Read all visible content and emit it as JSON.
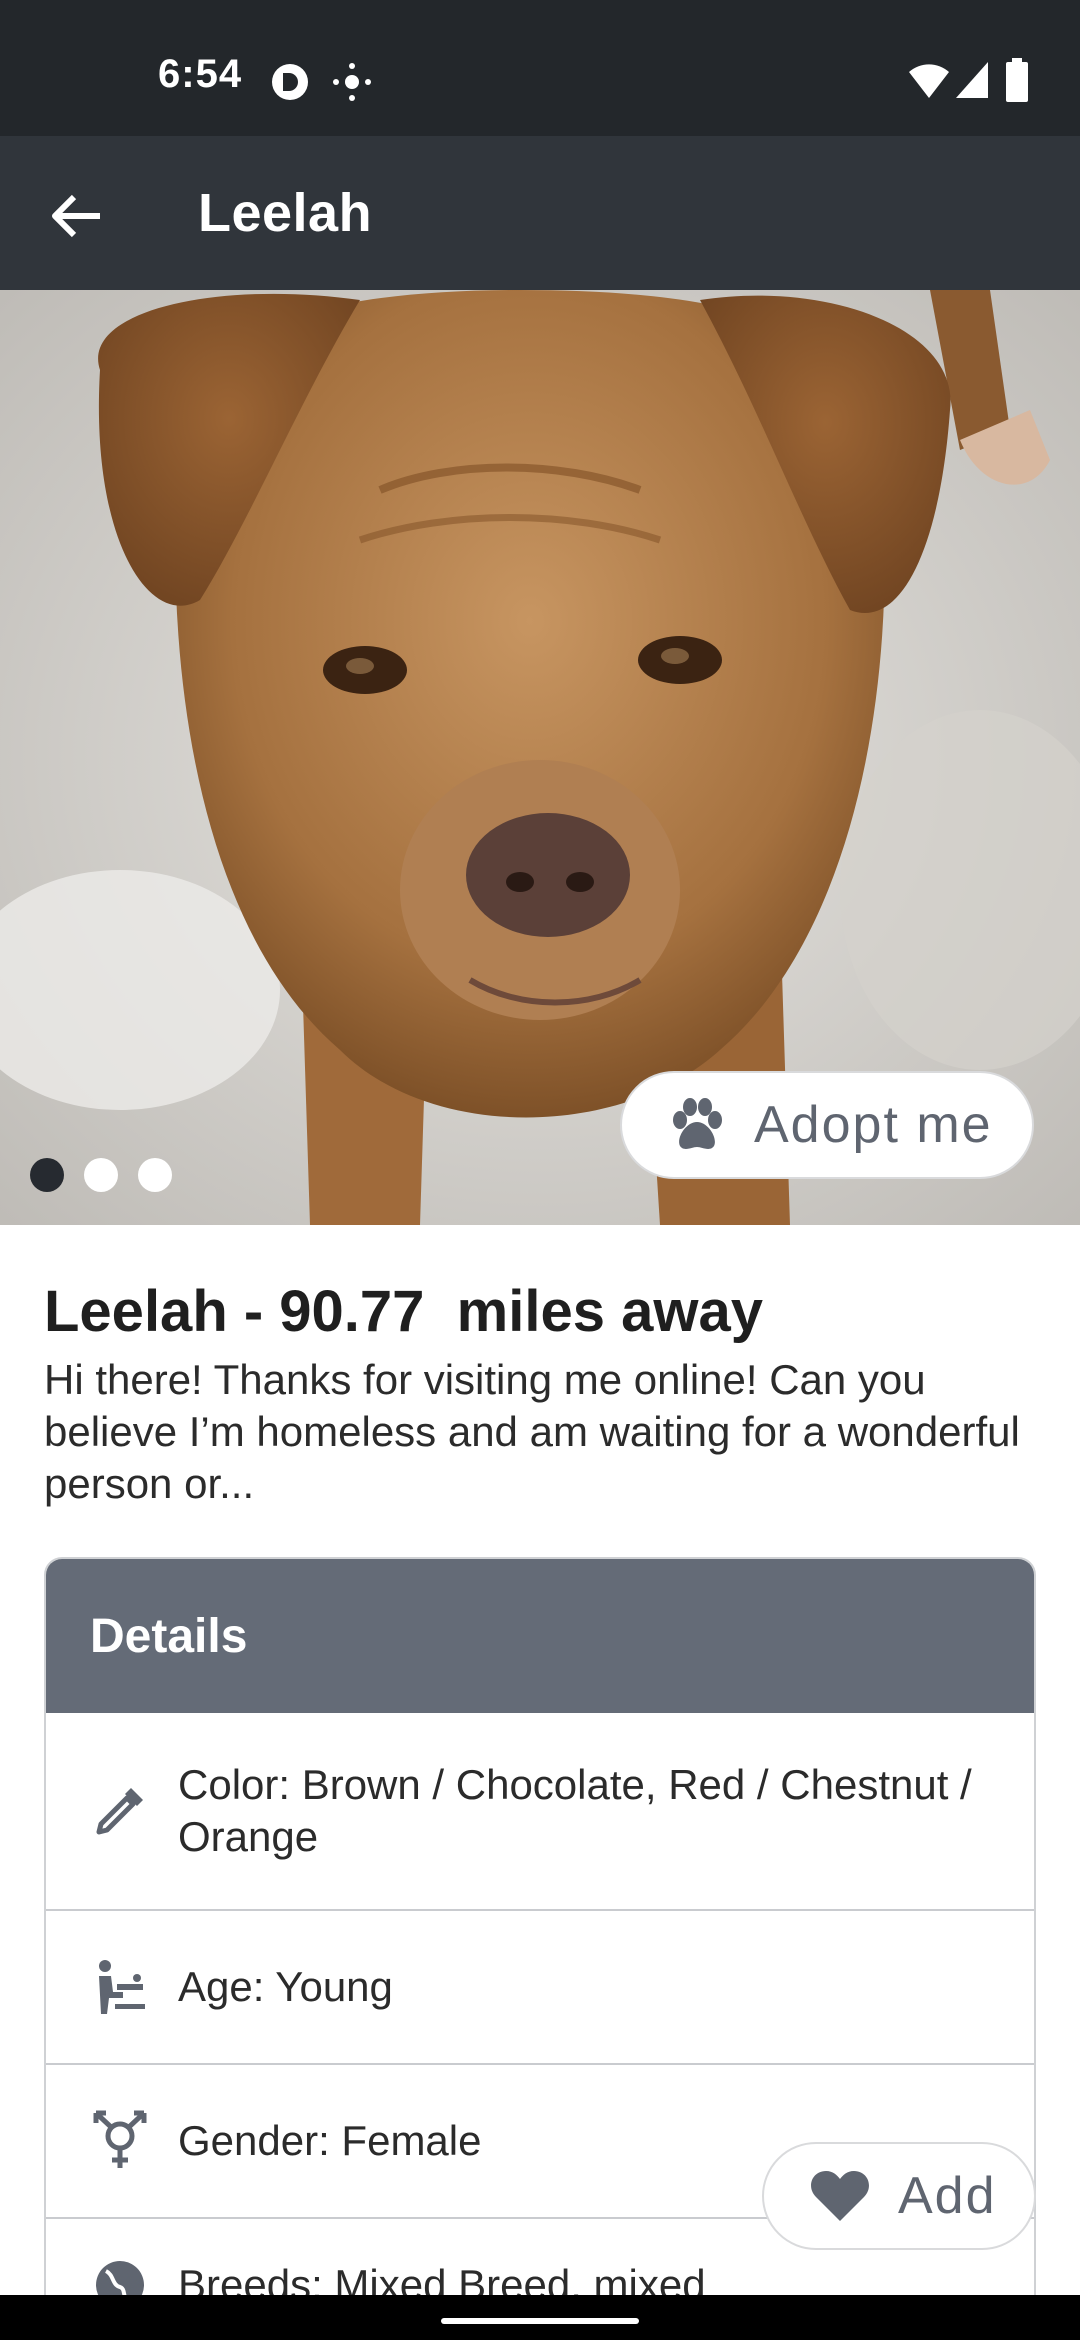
{
  "status_bar": {
    "time": "6:54",
    "left_icons": [
      "screen-record-icon",
      "location-icon"
    ],
    "right_icons": [
      "wifi-icon",
      "signal-icon",
      "battery-icon"
    ]
  },
  "app_bar": {
    "title": "Leelah",
    "back_icon": "arrow-back-icon"
  },
  "gallery": {
    "photo_count": 3,
    "active_index": 0,
    "adopt_button": {
      "label": "Adopt me",
      "icon": "paw-icon"
    }
  },
  "pet": {
    "headline": "Leelah - 90.77  miles away",
    "description": "Hi there! Thanks for visiting me online! Can you believe I’m homeless and am waiting for a wonderful person or..."
  },
  "details": {
    "header": "Details",
    "rows": [
      {
        "icon": "eyedropper-icon",
        "text": "Color: Brown / Chocolate, Red / Chestnut / Orange"
      },
      {
        "icon": "baby-changing-icon",
        "text": "Age: Young"
      },
      {
        "icon": "gender-icon",
        "text": "Gender: Female"
      },
      {
        "icon": "globe-icon",
        "text": "Breeds: Mixed Breed, mixed"
      }
    ]
  },
  "add_button": {
    "label": "Add",
    "icon": "heart-icon"
  },
  "colors": {
    "status_bar": "#23272b",
    "app_bar": "#30353b",
    "details_header": "#646b77",
    "button_text": "#5f6570"
  }
}
